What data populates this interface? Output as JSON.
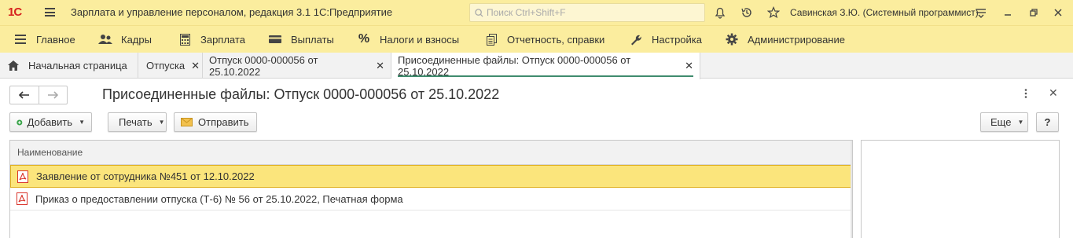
{
  "titlebar": {
    "logo": "1С",
    "title": "Зарплата и управление персоналом, редакция 3.1 1С:Предприятие",
    "search_placeholder": "Поиск Ctrl+Shift+F",
    "user": "Савинская З.Ю. (Системный программист)"
  },
  "sections": [
    {
      "label": "Главное",
      "icon": "menu-lines-icon"
    },
    {
      "label": "Кадры",
      "icon": "people-icon"
    },
    {
      "label": "Зарплата",
      "icon": "calculator-icon"
    },
    {
      "label": "Выплаты",
      "icon": "wallet-icon"
    },
    {
      "label": "Налоги и взносы",
      "icon": "percent-icon"
    },
    {
      "label": "Отчетность, справки",
      "icon": "documents-icon"
    },
    {
      "label": "Настройка",
      "icon": "wrench-icon"
    },
    {
      "label": "Администрирование",
      "icon": "gear-icon"
    }
  ],
  "tabs": [
    {
      "label": "Начальная страница"
    },
    {
      "label": "Отпуска"
    },
    {
      "label": "Отпуск 0000-000056 от 25.10.2022"
    },
    {
      "label": "Присоединенные файлы: Отпуск 0000-000056 от 25.10.2022"
    }
  ],
  "form": {
    "title": "Присоединенные файлы: Отпуск 0000-000056 от 25.10.2022"
  },
  "toolbar": {
    "add": "Добавить",
    "print": "Печать",
    "send": "Отправить",
    "more": "Еще",
    "help": "?"
  },
  "table": {
    "column_name": "Наименование",
    "rows": [
      "Заявление от сотрудника №451 от 12.10.2022",
      "Приказ о предоставлении отпуска (Т-6) № 56 от 25.10.2022, Печатная форма"
    ]
  },
  "colors": {
    "accent_bar": "#fbed9e",
    "selected_row": "#fbe57c",
    "active_tab_underline": "#3f8c6e"
  }
}
